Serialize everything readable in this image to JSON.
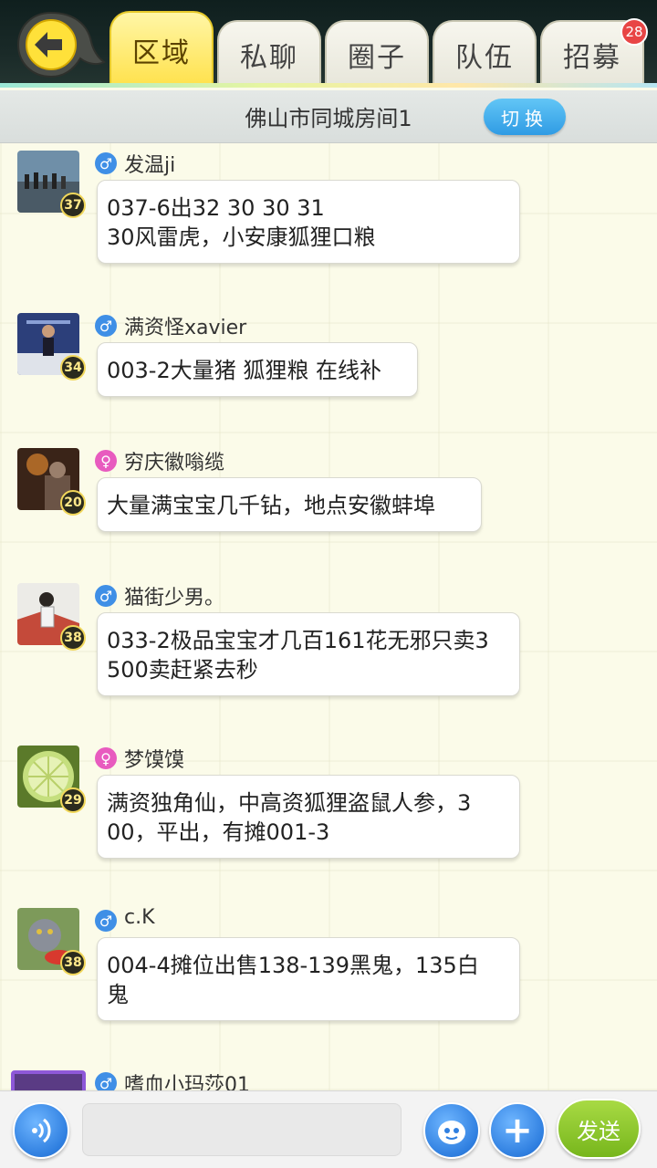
{
  "tabs": [
    {
      "label": "区域",
      "active": true
    },
    {
      "label": "私聊",
      "active": false
    },
    {
      "label": "圈子",
      "active": false
    },
    {
      "label": "队伍",
      "active": false
    },
    {
      "label": "招募",
      "active": false,
      "badge": "28"
    }
  ],
  "room": {
    "title": "佛山市同城房间1",
    "switch_label": "切换"
  },
  "messages": [
    {
      "name": "发温ji",
      "gender": "male",
      "level": "37",
      "text": [
        "037-6出32 30 30 31",
        "30风雷虎，小安康狐狸口粮"
      ]
    },
    {
      "name": "满资怪xavier",
      "gender": "male",
      "level": "34",
      "text": [
        "003-2大量猪 狐狸粮 在线补"
      ]
    },
    {
      "name": "穷庆徽嗡缆",
      "gender": "female",
      "level": "20",
      "text": [
        "大量满宝宝几千钻，地点安徽蚌埠"
      ]
    },
    {
      "name": "猫街少男。",
      "gender": "male",
      "level": "38",
      "text": [
        "033-2极品宝宝才几百161花无邪只卖3",
        "500卖赶紧去秒"
      ]
    },
    {
      "name": "梦馍馍",
      "gender": "female",
      "level": "29",
      "text": [
        "满资独角仙，中高资狐狸盗鼠人参，3",
        "00，平出，有摊001-3"
      ]
    },
    {
      "name": "c.K",
      "gender": "male",
      "level": "38",
      "text": [
        "004-4摊位出售138-139黑鬼，135白",
        "鬼"
      ]
    },
    {
      "name": "嗜血小玛莎01",
      "gender": "male",
      "level": "",
      "text": []
    }
  ],
  "input": {
    "value": "",
    "placeholder": ""
  },
  "send_label": "发送",
  "colors": {
    "accent_tab": "#ffe14a",
    "switch": "#2f9be4",
    "send": "#77b61c",
    "male": "#3f8fe6",
    "female": "#e85bbf",
    "badge": "#e84545"
  }
}
